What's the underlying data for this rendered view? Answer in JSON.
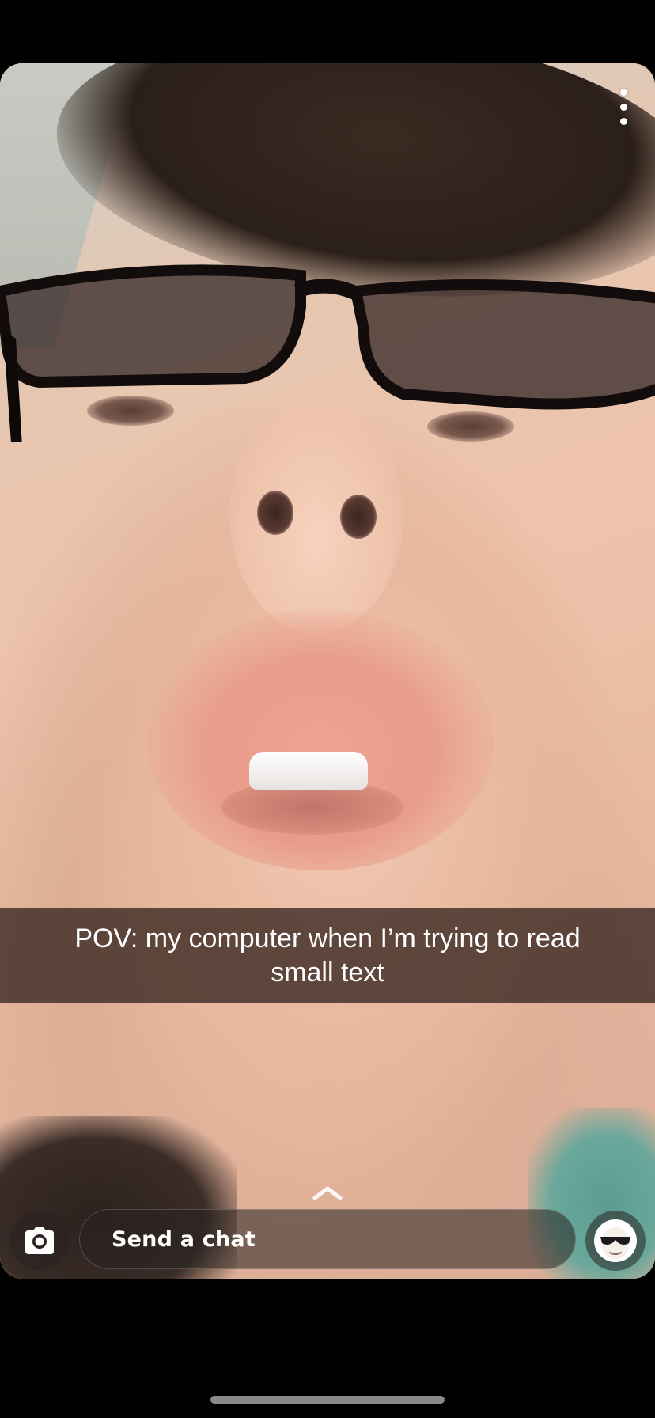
{
  "snap": {
    "caption": "POV: my computer when I’m trying to read small text"
  },
  "menu": {
    "icon": "more-vertical-icon"
  },
  "chat": {
    "placeholder": "Send a chat",
    "camera_icon": "camera-icon",
    "bitmoji_icon": "bitmoji-sunglasses-icon",
    "swipe_up_icon": "chevron-up-icon"
  },
  "colors": {
    "background": "#000000",
    "caption_bar": "#3e2c24",
    "text": "#ffffff"
  }
}
